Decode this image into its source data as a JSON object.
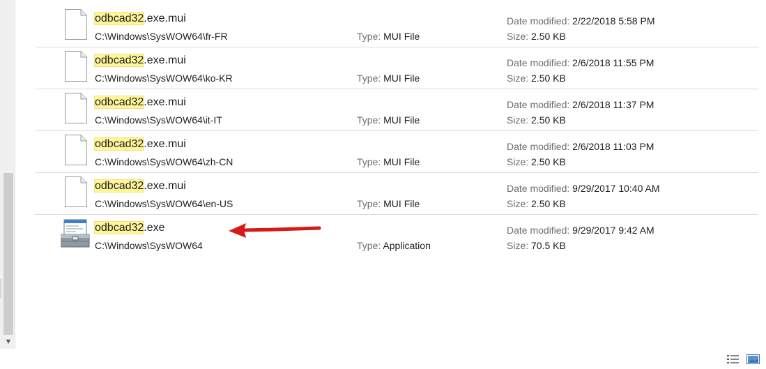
{
  "results": [
    {
      "name_match": "odbcad32",
      "name_rest": ".exe.mui",
      "path": "C:\\Windows\\SysWOW64\\fr-FR",
      "type_label": "Type:",
      "type": "MUI File",
      "date_label": "Date modified:",
      "date": "2/22/2018 5:58 PM",
      "size_label": "Size:",
      "size": "2.50 KB",
      "icon": "document-icon"
    },
    {
      "name_match": "odbcad32",
      "name_rest": ".exe.mui",
      "path": "C:\\Windows\\SysWOW64\\ko-KR",
      "type_label": "Type:",
      "type": "MUI File",
      "date_label": "Date modified:",
      "date": "2/6/2018 11:55 PM",
      "size_label": "Size:",
      "size": "2.50 KB",
      "icon": "document-icon"
    },
    {
      "name_match": "odbcad32",
      "name_rest": ".exe.mui",
      "path": "C:\\Windows\\SysWOW64\\it-IT",
      "type_label": "Type:",
      "type": "MUI File",
      "date_label": "Date modified:",
      "date": "2/6/2018 11:37 PM",
      "size_label": "Size:",
      "size": "2.50 KB",
      "icon": "document-icon"
    },
    {
      "name_match": "odbcad32",
      "name_rest": ".exe.mui",
      "path": "C:\\Windows\\SysWOW64\\zh-CN",
      "type_label": "Type:",
      "type": "MUI File",
      "date_label": "Date modified:",
      "date": "2/6/2018 11:03 PM",
      "size_label": "Size:",
      "size": "2.50 KB",
      "icon": "document-icon"
    },
    {
      "name_match": "odbcad32",
      "name_rest": ".exe.mui",
      "path": "C:\\Windows\\SysWOW64\\en-US",
      "type_label": "Type:",
      "type": "MUI File",
      "date_label": "Date modified:",
      "date": "9/29/2017 10:40 AM",
      "size_label": "Size:",
      "size": "2.50 KB",
      "icon": "document-icon"
    },
    {
      "name_match": "odbcad32",
      "name_rest": ".exe",
      "path": "C:\\Windows\\SysWOW64",
      "type_label": "Type:",
      "type": "Application",
      "date_label": "Date modified:",
      "date": "9/29/2017 9:42 AM",
      "size_label": "Size:",
      "size": "70.5 KB",
      "icon": "toolbox-application-icon"
    }
  ],
  "scrollbar": {
    "down_arrow": "chevron-down-icon"
  },
  "statusbar": {
    "details_view_icon": "details-view-icon",
    "large_icons_view_icon": "large-icons-view-icon"
  },
  "annotation": {
    "arrow_color": "#d51a1a",
    "highlight_color": "#fff599"
  }
}
